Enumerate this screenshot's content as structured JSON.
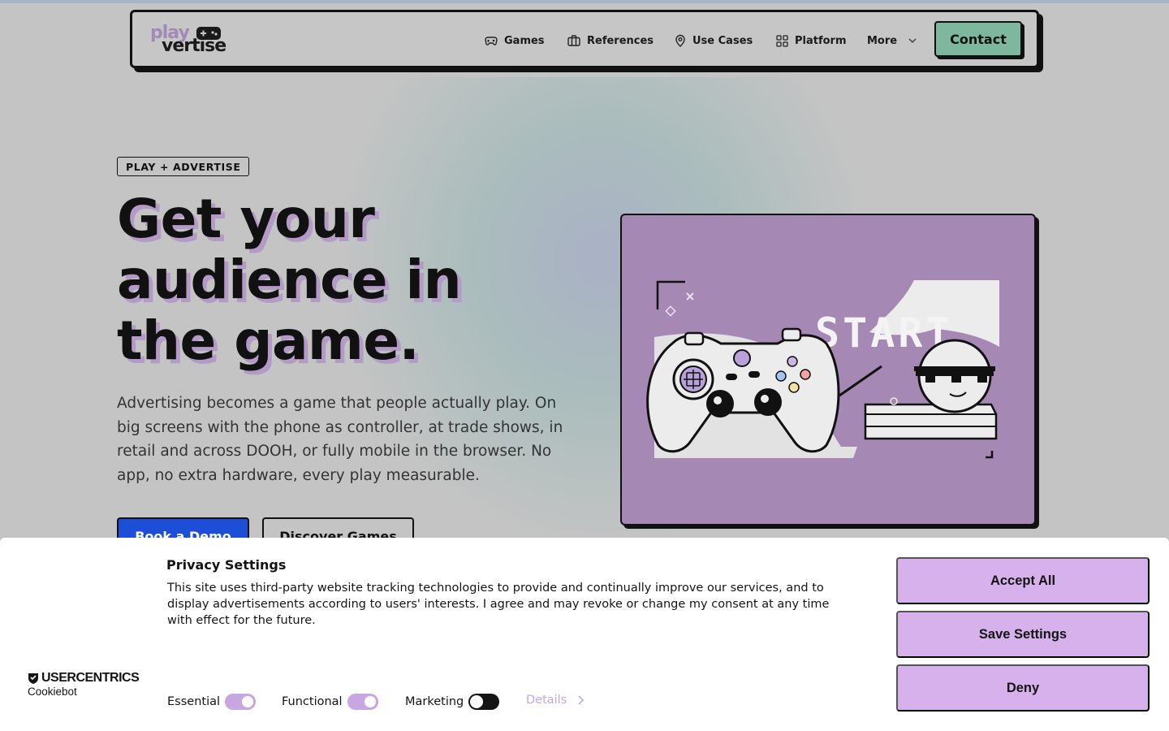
{
  "nav": {
    "logo_top": "play",
    "logo_bottom": "vertise",
    "items": [
      {
        "label": "Games",
        "icon": "gamepad-icon"
      },
      {
        "label": "References",
        "icon": "briefcase-icon"
      },
      {
        "label": "Use Cases",
        "icon": "map-pin-icon"
      },
      {
        "label": "Platform",
        "icon": "grid-icon"
      },
      {
        "label": "More",
        "icon": "chevron-down-icon"
      }
    ],
    "contact_label": "Contact"
  },
  "hero": {
    "badge": "PLAY + ADVERTISE",
    "headline_line1": "Get your",
    "headline_line2": "audience in",
    "headline_line3": "the game.",
    "lead": "Advertising becomes a game that people actually play. On big screens with the phone as controller, at trade shows, in retail and across DOOH, or fully mobile in the browser. No app, no extra hardware, every play measurable.",
    "primary_cta": "Book a Demo",
    "secondary_cta": "Discover Games",
    "illustration_text": "START"
  },
  "cookie": {
    "title": "Privacy Settings",
    "text": "This site uses third-party website tracking technologies to provide and continually improve our services, and to display advertisements according to users' interests. I agree and may revoke or change my consent at any time with effect for the future.",
    "brand": "USERCENTRICS",
    "brand_sub": "Cookiebot",
    "toggles": [
      {
        "label": "Essential",
        "on": true
      },
      {
        "label": "Functional",
        "on": true
      },
      {
        "label": "Marketing",
        "on": false
      }
    ],
    "details_label": "Details",
    "accept_label": "Accept All",
    "save_label": "Save Settings",
    "deny_label": "Deny"
  },
  "colors": {
    "accent_purple": "#d6b1ec",
    "contact_green": "#7db79e",
    "demo_blue": "#1c4ed8",
    "illustration_bg": "#a688b5"
  }
}
